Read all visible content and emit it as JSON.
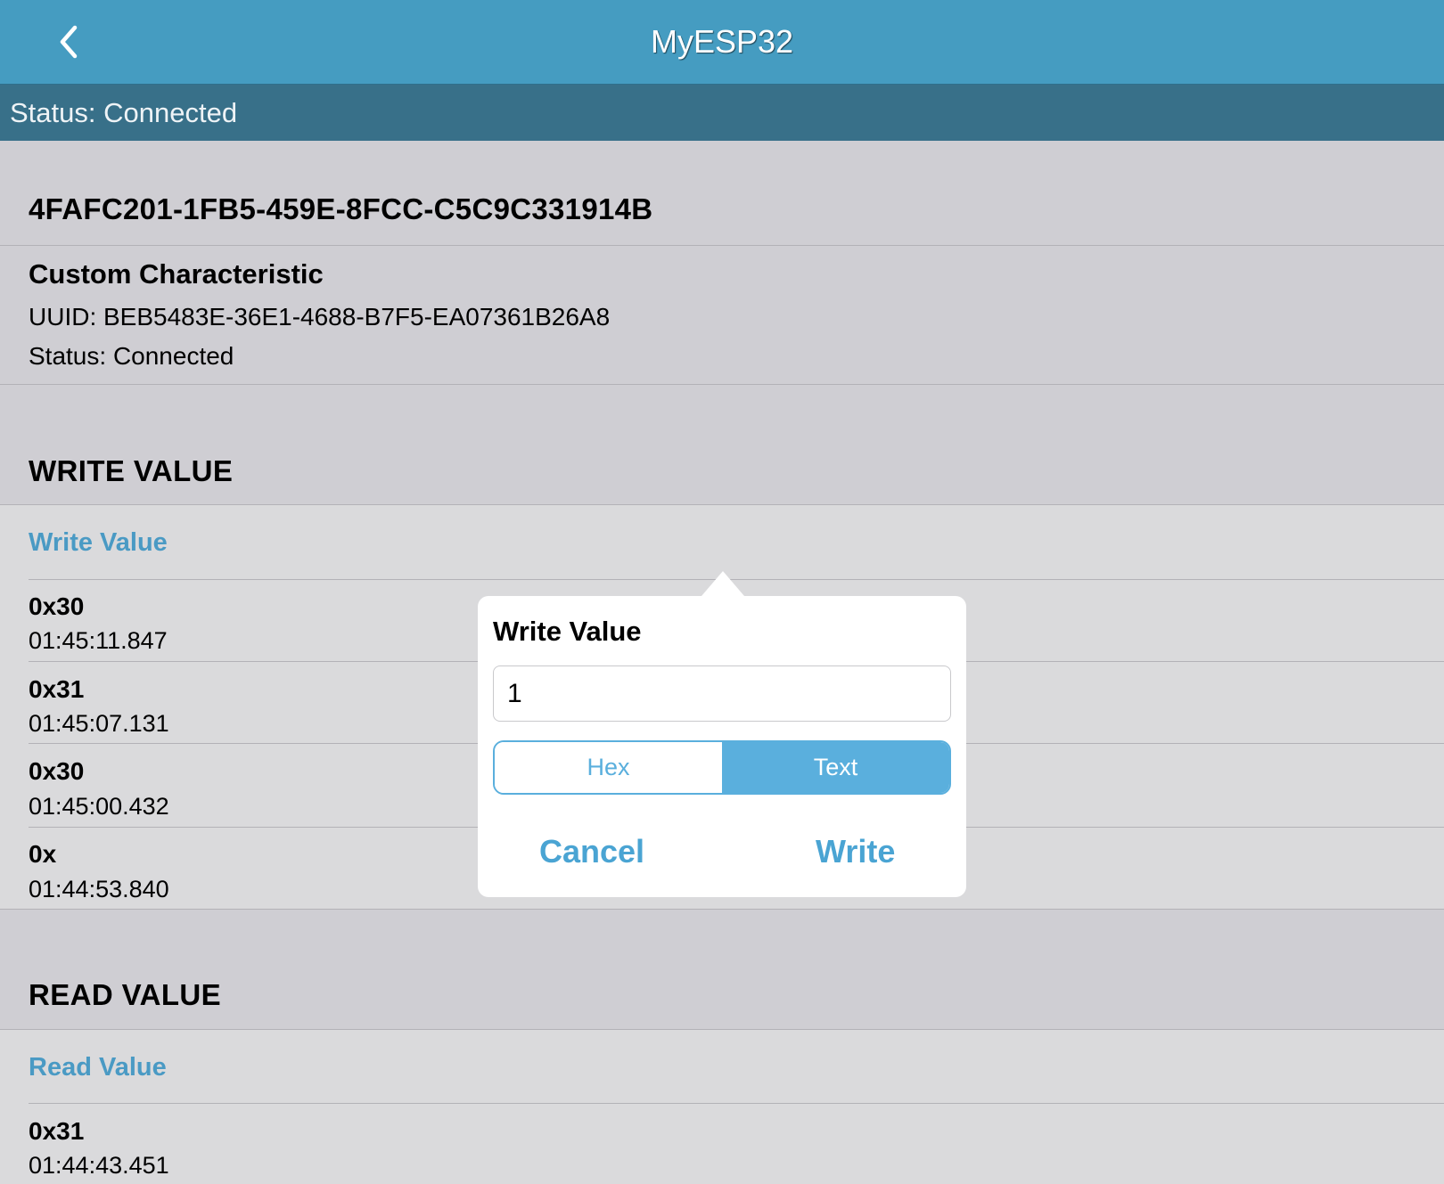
{
  "nav": {
    "title": "MyESP32",
    "back_icon": "chevron-left-icon"
  },
  "status_bar": {
    "text": "Status: Connected"
  },
  "service": {
    "uuid": "4FAFC201-1FB5-459E-8FCC-C5C9C331914B"
  },
  "characteristic": {
    "name": "Custom Characteristic",
    "uuid_line": "UUID: BEB5483E-36E1-4688-B7F5-EA07361B26A8",
    "status_line": "Status: Connected"
  },
  "write_section": {
    "title": "WRITE VALUE",
    "action_label": "Write Value",
    "log": [
      {
        "value": "0x30",
        "time": "01:45:11.847"
      },
      {
        "value": "0x31",
        "time": "01:45:07.131"
      },
      {
        "value": "0x30",
        "time": "01:45:00.432"
      },
      {
        "value": "0x",
        "time": "01:44:53.840"
      }
    ]
  },
  "read_section": {
    "title": "READ VALUE",
    "action_label": "Read Value",
    "log": [
      {
        "value": "0x31",
        "time": "01:44:43.451"
      }
    ]
  },
  "dialog": {
    "title": "Write Value",
    "input_value": "1",
    "format_options": [
      "Hex",
      "Text"
    ],
    "selected_format": "Text",
    "cancel_label": "Cancel",
    "write_label": "Write"
  },
  "colors": {
    "nav_bg": "#459cc1",
    "status_bg": "#387089",
    "accent": "#5aafdd",
    "link": "#4a9ac4",
    "page_bg": "#cfced3"
  }
}
